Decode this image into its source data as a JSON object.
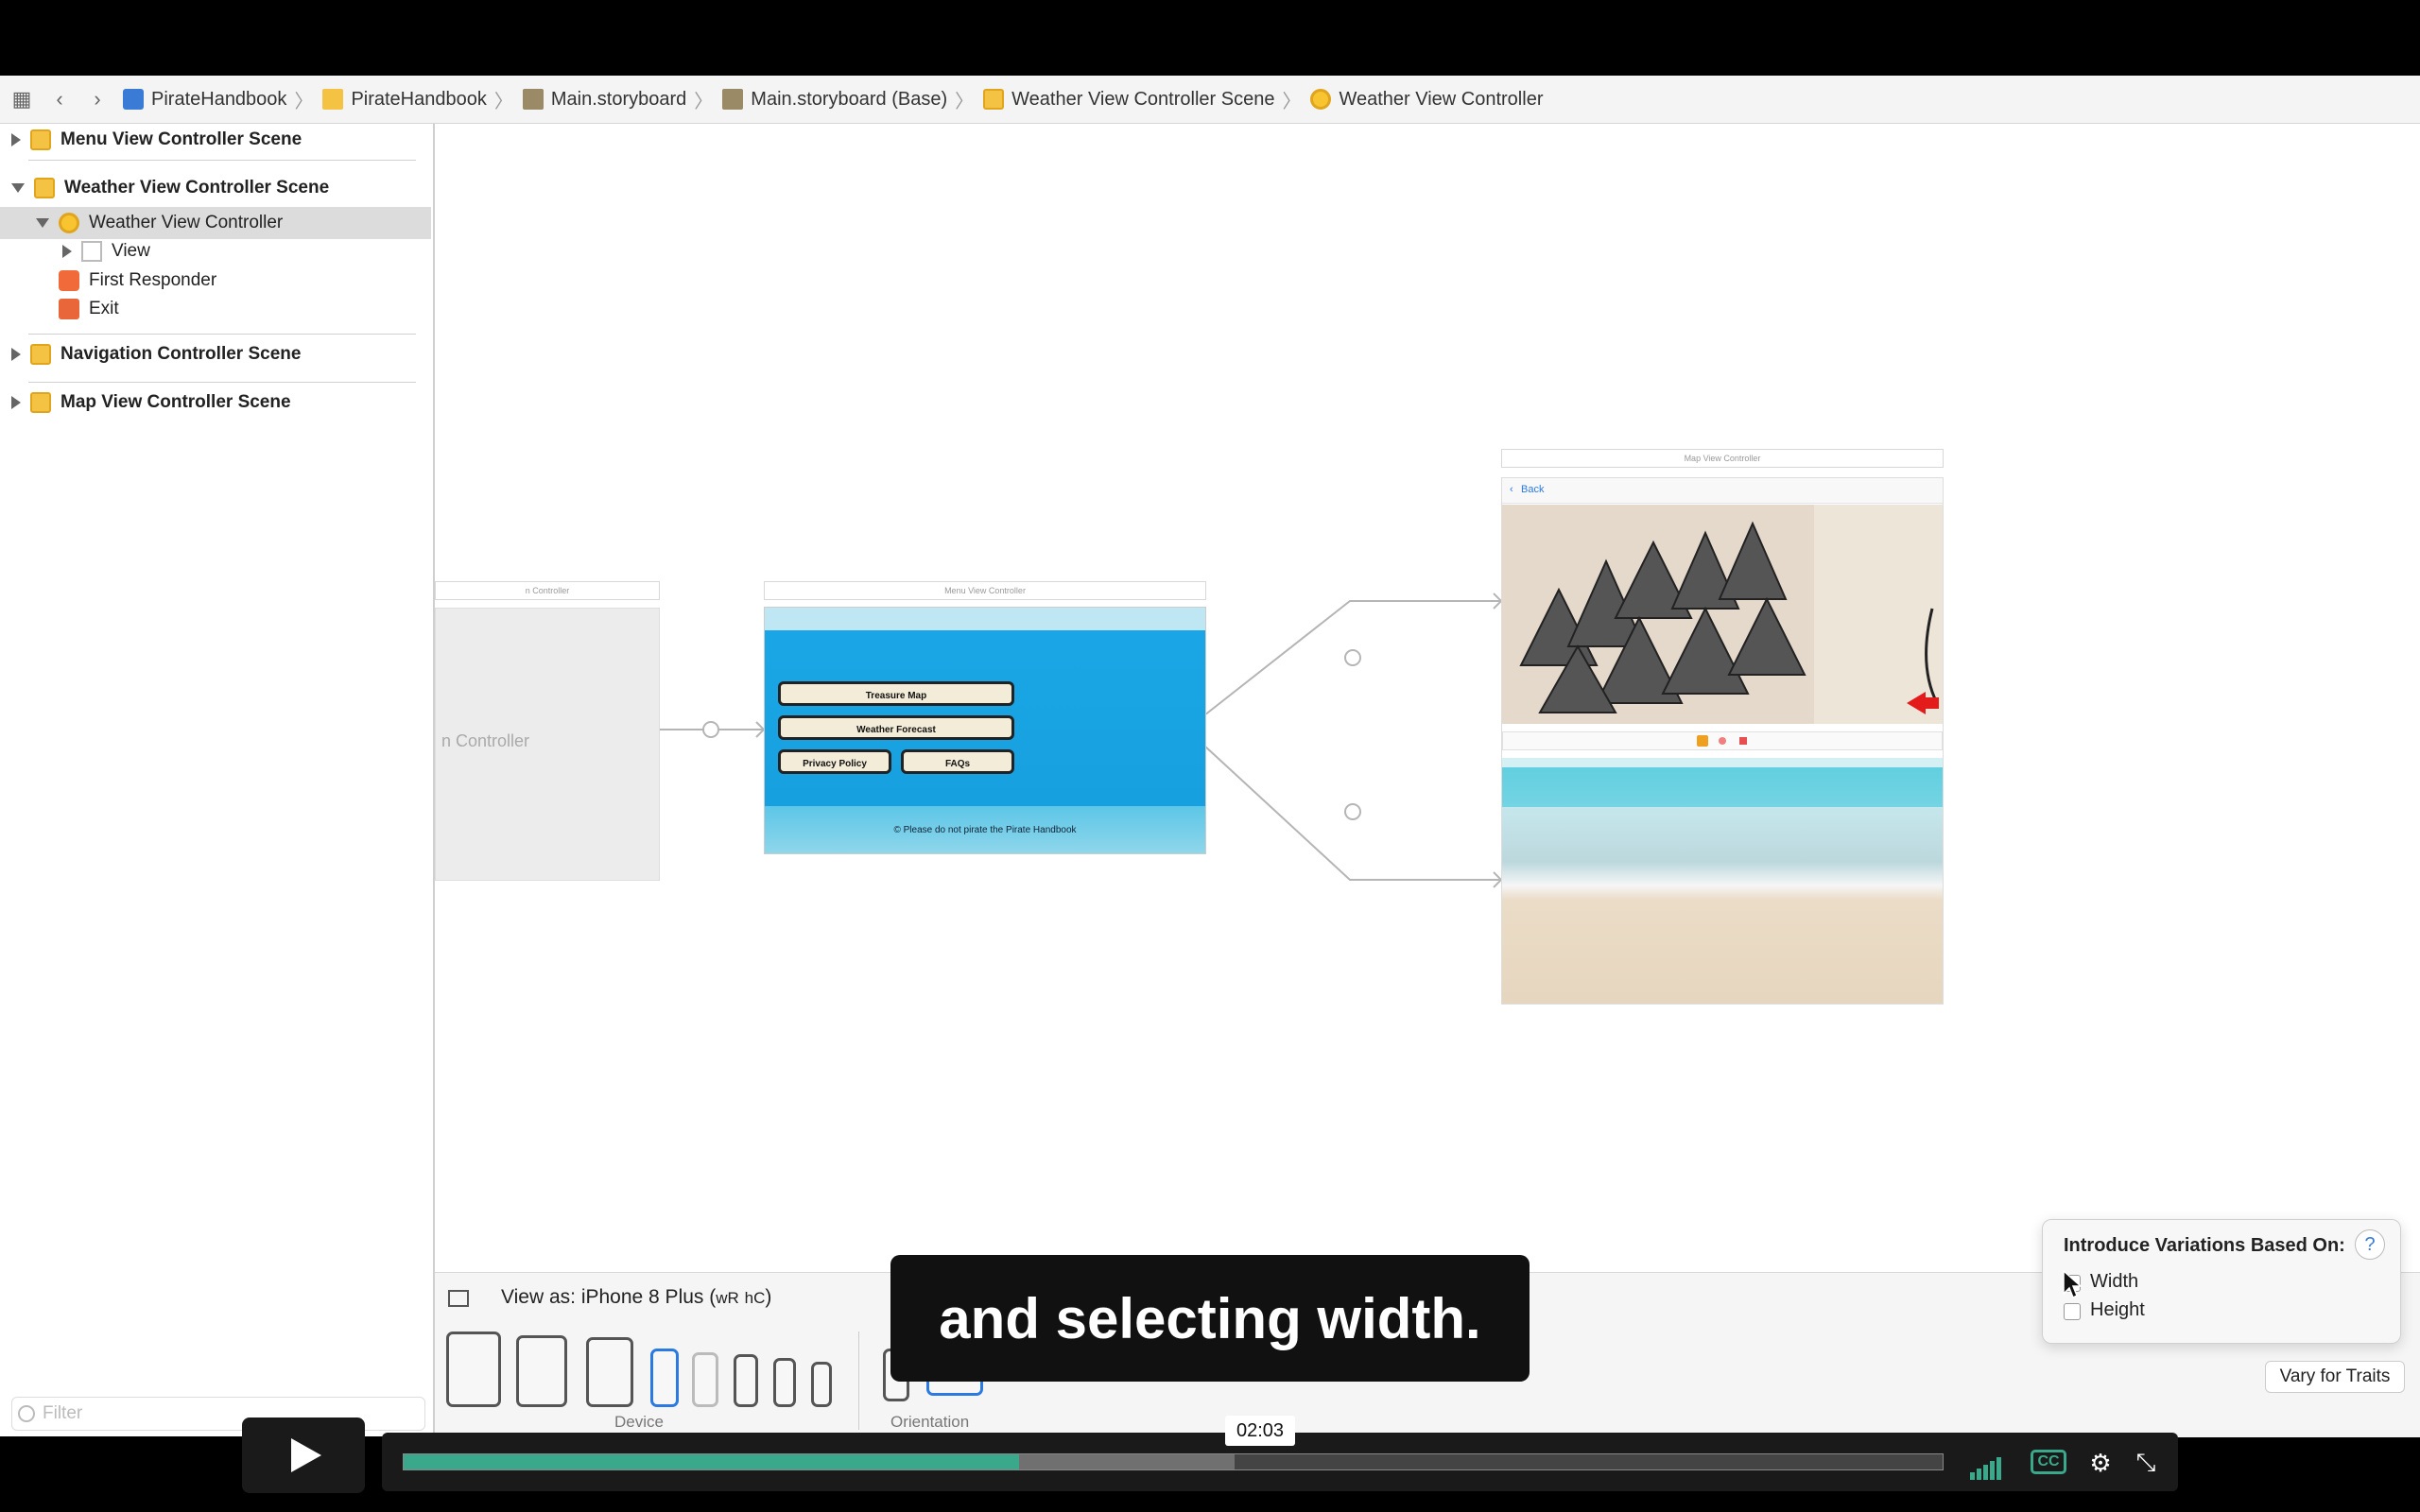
{
  "breadcrumbs": [
    {
      "label": "PirateHandbook",
      "icon": "swift-project-icon"
    },
    {
      "label": "PirateHandbook",
      "icon": "folder-icon"
    },
    {
      "label": "Main.storyboard",
      "icon": "storyboard-icon"
    },
    {
      "label": "Main.storyboard (Base)",
      "icon": "storyboard-icon"
    },
    {
      "label": "Weather View Controller Scene",
      "icon": "scene-icon"
    },
    {
      "label": "Weather View Controller",
      "icon": "view-controller-icon"
    }
  ],
  "outline": {
    "items": [
      {
        "label": "Menu View Controller Scene"
      },
      {
        "label": "Weather View Controller Scene"
      },
      {
        "label": "Weather View Controller"
      },
      {
        "label": "View"
      },
      {
        "label": "First Responder"
      },
      {
        "label": "Exit"
      },
      {
        "label": "Navigation Controller Scene"
      },
      {
        "label": "Map View Controller Scene"
      }
    ],
    "filter_placeholder": "Filter"
  },
  "canvas": {
    "nav_scene_label": "n Controller",
    "nav_scene_title": "n Controller",
    "menu_scene_title": "Menu View Controller",
    "menu_buttons": [
      "Treasure Map",
      "Weather Forecast",
      "Privacy Policy",
      "FAQs"
    ],
    "menu_footer": "© Please do not pirate the Pirate Handbook",
    "map_scene_title": "Map View Controller",
    "map_back": "Back"
  },
  "device_bar": {
    "view_as_prefix": "View as: iPhone 8 Plus (",
    "trait_w": "wR",
    "trait_h": "hC",
    "view_as_suffix": ")",
    "device_label": "Device",
    "orientation_label": "Orientation"
  },
  "popover": {
    "title": "Introduce Variations Based On:",
    "help": "?",
    "options": [
      {
        "label": "Width",
        "checked": false
      },
      {
        "label": "Height",
        "checked": false
      }
    ],
    "vary_button": "Vary for Traits"
  },
  "caption": "and selecting width.",
  "player": {
    "time": "02:03",
    "progress": 0.4,
    "buffered": 0.54,
    "cc_label": "CC",
    "accent": "#3aa88a"
  }
}
